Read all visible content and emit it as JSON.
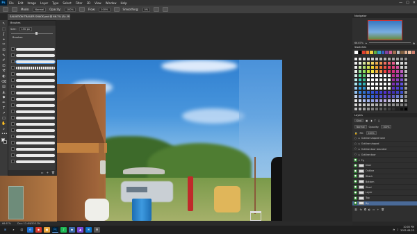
{
  "menubar": {
    "app_icon": "Ps",
    "items": [
      "File",
      "Edit",
      "Image",
      "Layer",
      "Type",
      "Select",
      "Filter",
      "3D",
      "View",
      "Window",
      "Help"
    ],
    "window_controls": [
      "—",
      "▢",
      "✕"
    ]
  },
  "options": {
    "mode_label": "Mode:",
    "mode_value": "Normal",
    "opacity_label": "Opacity:",
    "opacity_value": "100%",
    "flow_label": "Flow:",
    "flow_value": "100%",
    "smoothing_label": "Smoothing:",
    "smoothing_value": "0%"
  },
  "document": {
    "tab_title": "SALVATION TRAILER SHACK.psd @ 66.7% (Sc. RGB/8)"
  },
  "brushes": {
    "title": "Brushes",
    "size_label": "Size:",
    "size_value": "150 px",
    "group_name": "Brushes"
  },
  "tools": [
    "↖",
    "⬚",
    "ʆ",
    "⌖",
    "✂",
    "⊡",
    "✎",
    "✐",
    "⎚",
    "⚒",
    "◐",
    "⌫",
    "▤",
    "◭",
    "◆",
    "✏",
    "T",
    "↗",
    "☐",
    "✋",
    "⌕",
    "•••"
  ],
  "navigator": {
    "title": "Navigator",
    "zoom_value": "66.67%"
  },
  "swatches_panel": {
    "title": "Swatches",
    "colors": [
      "#ffffff",
      "#000000",
      "#e04030",
      "#f08030",
      "#f0d040",
      "#60b040",
      "#30a0c0",
      "#3060c0",
      "#8040a0",
      "#d06090",
      "#a07050",
      "#c0c0c0",
      "#806040",
      "#e0b090",
      "#f0c0a0",
      "#d08070"
    ]
  },
  "color_wheel": {
    "colors": [
      "#f0f0f0",
      "#e8e8e8",
      "#e0e0e0",
      "#d8d8d8",
      "#d0d0d0",
      "#c8c8c8",
      "#c0c0c0",
      "#b8b8b8",
      "#b0b0b0",
      "#a8a8a8",
      "#a0a0a0",
      "#989898",
      "#909090",
      "#f0f0f0",
      "#e8f0e0",
      "#d8e8a0",
      "#e8e080",
      "#f0d060",
      "#f0b050",
      "#f09050",
      "#f07060",
      "#f06070",
      "#e86090",
      "#e0e0e0",
      "#d8d8d8",
      "#d0d0d0",
      "#f0f0f0",
      "#c8e8a0",
      "#b0e070",
      "#d0e050",
      "#f0d030",
      "#f0a030",
      "#f07030",
      "#f05040",
      "#f04060",
      "#e04080",
      "#d050a0",
      "#d0d0d0",
      "#c8c8c8",
      "#e8f0e8",
      "#90e090",
      "#90e060",
      "#c0e040",
      "#f0e040",
      "#f0b040",
      "#f08040",
      "#f04040",
      "#e03060",
      "#d03080",
      "#c040a0",
      "#c060c0",
      "#c0c0c0",
      "#d8f0e8",
      "#60e0a0",
      "#60d070",
      "#f0f0f0",
      "#ffffff",
      "#ffffff",
      "#ffffff",
      "#ffffff",
      "#f0f0f0",
      "#c03090",
      "#b040b0",
      "#a050c0",
      "#b8b8b8",
      "#c0f0f0",
      "#40d0c0",
      "#40c090",
      "#ffffff",
      "#ffffff",
      "#ffffff",
      "#ffffff",
      "#ffffff",
      "#ffffff",
      "#a030a0",
      "#9040c0",
      "#8050d0",
      "#b0b0b0",
      "#b0e8f0",
      "#30c0e0",
      "#30b0b0",
      "#ffffff",
      "#ffffff",
      "#ffffff",
      "#ffffff",
      "#ffffff",
      "#ffffff",
      "#8030b0",
      "#7040d0",
      "#6050e0",
      "#a8a8a8",
      "#a0d0f0",
      "#30a0e0",
      "#3090d0",
      "#f0f0f0",
      "#ffffff",
      "#ffffff",
      "#ffffff",
      "#ffffff",
      "#f0f0f0",
      "#6030c0",
      "#5040d0",
      "#4050e0",
      "#a0a0a0",
      "#90c0f0",
      "#3080e0",
      "#3070d0",
      "#3060d0",
      "#3050d0",
      "#3040d0",
      "#4040d0",
      "#5030d0",
      "#5030c0",
      "#4030b0",
      "#4040c0",
      "#4050d0",
      "#989898",
      "#c8d8f0",
      "#80a0e0",
      "#5080e0",
      "#4070d8",
      "#3060d0",
      "#4050d0",
      "#5050d0",
      "#6050c8",
      "#6050b8",
      "#6060c0",
      "#7080d0",
      "#8090d0",
      "#909090",
      "#e8e8e8",
      "#d0d8f0",
      "#b0c0f0",
      "#a0b0e8",
      "#90a0e0",
      "#a0a0e0",
      "#b0a8e0",
      "#c0b0e0",
      "#c8c0e0",
      "#d0d0e8",
      "#d8d8e8",
      "#e0e0e0",
      "#888888",
      "#d8d8d8",
      "#d0d0d0",
      "#c8c8c8",
      "#c0c0c0",
      "#b8b8b8",
      "#b0b0b0",
      "#a8a8a8",
      "#a0a0a0",
      "#989898",
      "#909090",
      "#888888",
      "#808080",
      "#787878",
      "#c0c0c0",
      "#b0b0b0",
      "#a0a0a0",
      "#909090",
      "#808080",
      "#707070",
      "#606060",
      "#505050",
      "#404040",
      "#303030",
      "#202020",
      "#101010",
      "#000000"
    ]
  },
  "layers": {
    "title": "Layers",
    "kind_label": "Kind",
    "blend_mode": "Normal",
    "opacity_label": "Opacity:",
    "opacity_value": "100%",
    "fill_label": "Fill:",
    "fill_value": "100%",
    "items": [
      {
        "name": "Outline shaped tone"
      },
      {
        "name": "Outline shaped"
      },
      {
        "name": "Outline door branded"
      },
      {
        "name": "Outline door"
      },
      {
        "name": "Fg"
      },
      {
        "name": "Door"
      },
      {
        "name": "Outline"
      },
      {
        "name": "Shack"
      },
      {
        "name": "Bottom"
      },
      {
        "name": "Shed"
      },
      {
        "name": "Layer"
      },
      {
        "name": "Top"
      },
      {
        "name": "Bg"
      }
    ]
  },
  "status": {
    "zoom": "66.67%",
    "doc": "Doc: 12.4M/503.2M"
  },
  "taskbar": {
    "apps": [
      "⊞",
      "⌕",
      "◫",
      "e",
      "◉",
      "▣",
      "Ps",
      "♪",
      "◆",
      "▲",
      "✉",
      "⚙"
    ],
    "time": "10:05 PM",
    "date": "2021-08-23"
  }
}
